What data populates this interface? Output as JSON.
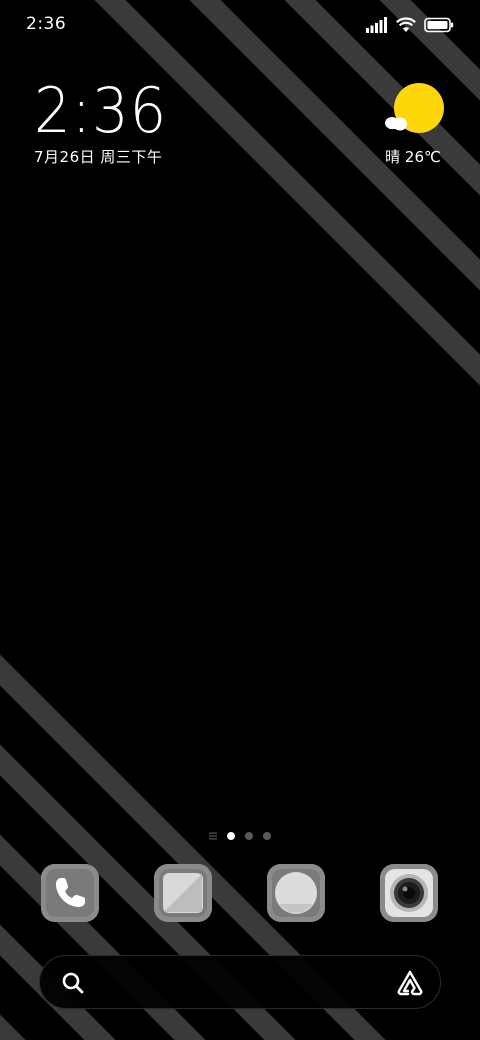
{
  "status_bar": {
    "time": "2:36",
    "icons": [
      "signal-icon",
      "wifi-icon",
      "battery-icon"
    ]
  },
  "clock_widget": {
    "time": "2:36",
    "date": "7月26日 周三下午"
  },
  "weather_widget": {
    "condition_icon": "sunny-cloud-icon",
    "text": "晴 26℃",
    "sun_color": "#FFD60A"
  },
  "home": {
    "pages": 3,
    "current_page": 1,
    "indicator_colors": {
      "active": "#FFFFFF",
      "inactive": "#5A5A5A"
    }
  },
  "dock": {
    "apps": [
      {
        "id": "phone",
        "icon": "phone-icon"
      },
      {
        "id": "messages",
        "icon": "messages-icon"
      },
      {
        "id": "browser",
        "icon": "browser-icon"
      },
      {
        "id": "camera",
        "icon": "camera-icon"
      }
    ]
  },
  "search_bar": {
    "search_icon": "search-icon",
    "assistant_icon": "assistant-icon"
  },
  "colors": {
    "background": "#000000",
    "stripe": "#3a3a3a",
    "app_tile": "#8d8d8d"
  }
}
